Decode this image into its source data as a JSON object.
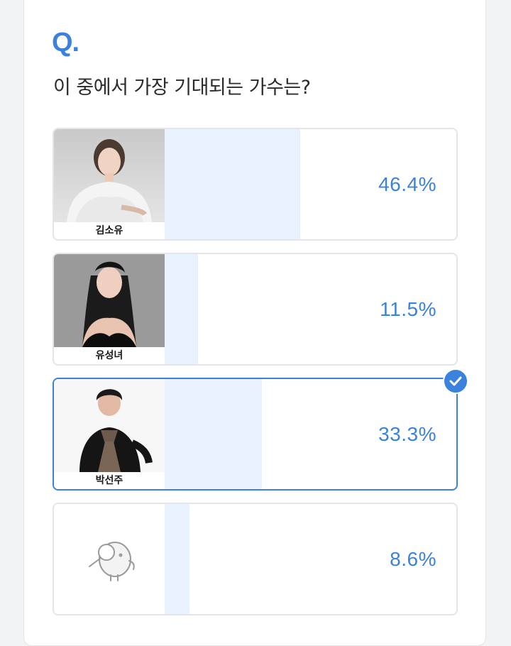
{
  "colors": {
    "accent": "#3b82dc",
    "bar_fill": "#e8f1fd",
    "border": "#e3e5e8"
  },
  "poll": {
    "q_mark": "Q.",
    "question": "이 중에서 가장 기대되는 가수는?",
    "options": [
      {
        "name": "김소유",
        "percent_label": "46.4%",
        "percent": 46.4,
        "selected": false,
        "image": "portrait-photo"
      },
      {
        "name": "유성녀",
        "percent_label": "11.5%",
        "percent": 11.5,
        "selected": false,
        "image": "portrait-photo"
      },
      {
        "name": "박선주",
        "percent_label": "33.3%",
        "percent": 33.3,
        "selected": true,
        "image": "portrait-photo"
      },
      {
        "name": "",
        "percent_label": "8.6%",
        "percent": 8.6,
        "selected": false,
        "image": "magnifier-mascot-icon"
      }
    ],
    "selected_icon": "check-icon"
  }
}
